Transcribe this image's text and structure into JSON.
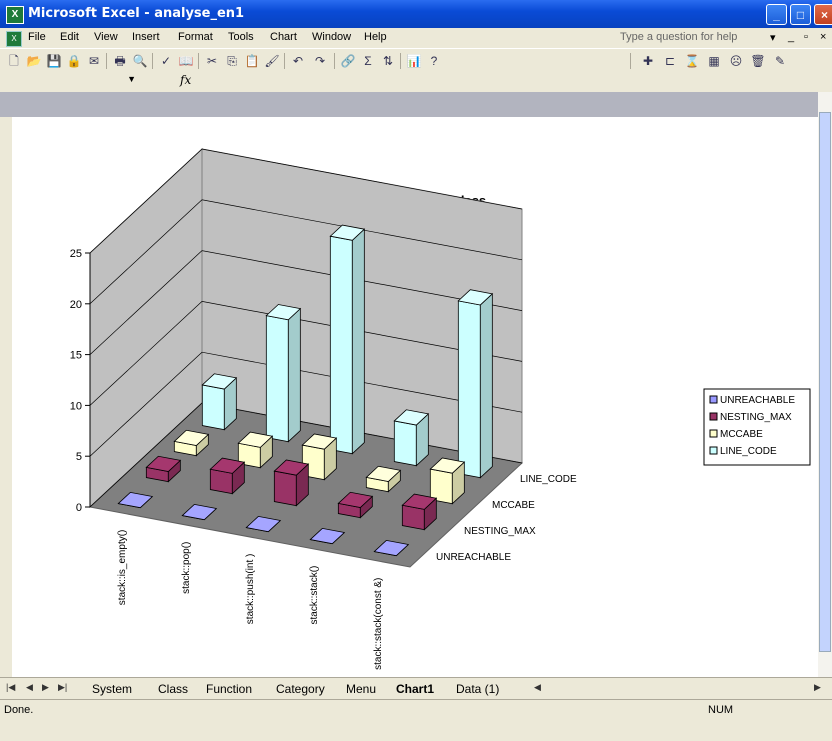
{
  "window": {
    "title": "Microsoft Excel - analyse_en1",
    "app_icon_letter": "X"
  },
  "menubar": {
    "items": [
      "File",
      "Edit",
      "View",
      "Insert",
      "Format",
      "Tools",
      "Chart",
      "Window",
      "Help"
    ],
    "help_placeholder": "Type a question for help"
  },
  "formula": {
    "fx": "fx"
  },
  "chart_data": {
    "type": "bar",
    "title": "Methods of stack class",
    "categories": [
      "stack::is_empty()",
      "stack::pop()",
      "stack::push(int )",
      "stack::stack()",
      "stack::stack(const &)"
    ],
    "series": [
      {
        "name": "UNREACHABLE",
        "values": [
          0,
          0,
          0,
          0,
          0
        ],
        "color": "#9999ff"
      },
      {
        "name": "NESTING_MAX",
        "values": [
          1,
          2,
          3,
          1,
          2
        ],
        "color": "#993366"
      },
      {
        "name": "MCCABE",
        "values": [
          1,
          2,
          3,
          1,
          3
        ],
        "color": "#ffffcc"
      },
      {
        "name": "LINE_CODE",
        "values": [
          4,
          12,
          21,
          4,
          17
        ],
        "color": "#ccffff"
      }
    ],
    "ylim": [
      0,
      25
    ],
    "yticks": [
      "0",
      "5",
      "10",
      "15",
      "20",
      "25"
    ],
    "grid": true,
    "legend_position": "right"
  },
  "sheet_tabs": [
    "System",
    "Class",
    "Function",
    "Category",
    "Menu",
    "Chart1",
    "Data (1)"
  ],
  "active_tab": "Chart1",
  "status": {
    "text": "Done.",
    "num": "NUM"
  }
}
